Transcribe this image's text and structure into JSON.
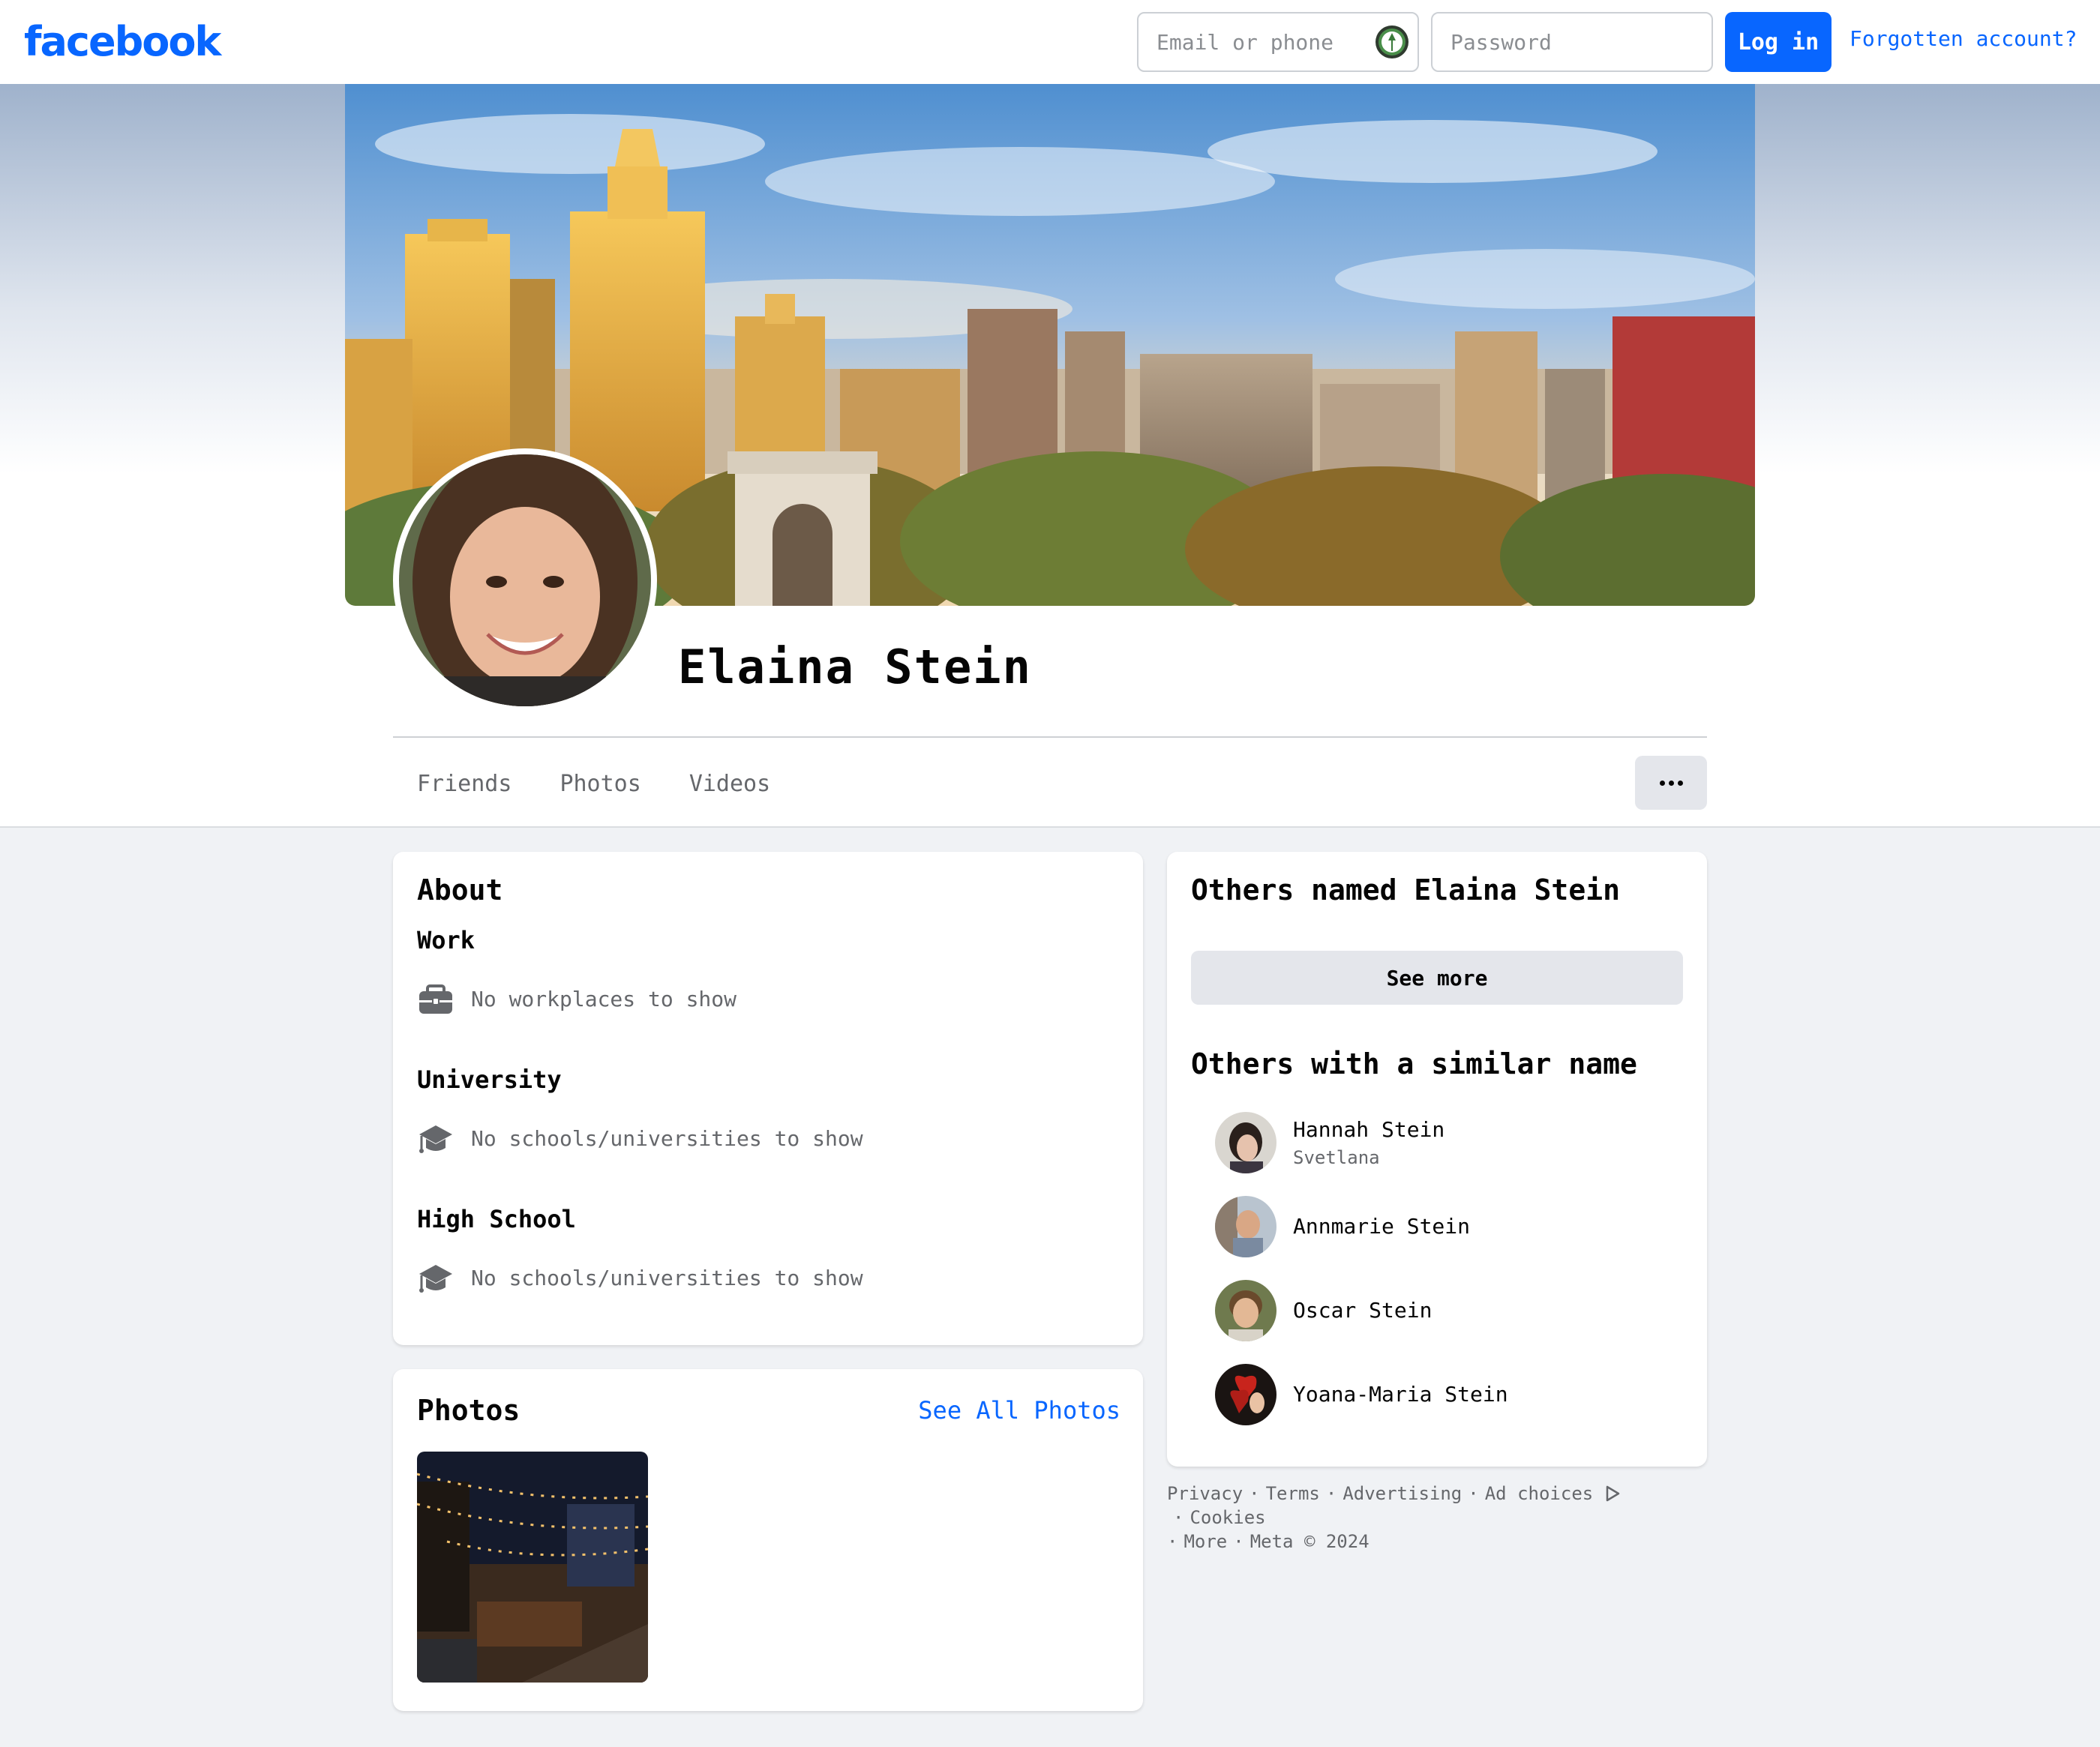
{
  "topbar": {
    "logo": "facebook",
    "email_placeholder": "Email or phone",
    "password_placeholder": "Password",
    "login_label": "Log in",
    "forgot_label": "Forgotten account?"
  },
  "profile": {
    "name": "Elaina Stein",
    "tabs": [
      "Friends",
      "Photos",
      "Videos"
    ]
  },
  "about": {
    "title": "About",
    "work": {
      "heading": "Work",
      "empty_text": "No workplaces to show"
    },
    "university": {
      "heading": "University",
      "empty_text": "No schools/universities to show"
    },
    "high_school": {
      "heading": "High School",
      "empty_text": "No schools/universities to show"
    }
  },
  "photos": {
    "title": "Photos",
    "see_all_label": "See All Photos"
  },
  "sidebar": {
    "others_named_title": "Others named Elaina Stein",
    "see_more_label": "See more",
    "similar_title": "Others with a similar name",
    "people": [
      {
        "name": "Hannah Stein",
        "subtitle": "Svetlana"
      },
      {
        "name": "Annmarie Stein",
        "subtitle": ""
      },
      {
        "name": "Oscar Stein",
        "subtitle": ""
      },
      {
        "name": "Yoana-Maria Stein",
        "subtitle": ""
      }
    ]
  },
  "footer": {
    "links": [
      "Privacy",
      "Terms",
      "Advertising",
      "Ad choices",
      "Cookies",
      "More"
    ],
    "copyright": "Meta © 2024"
  },
  "colors": {
    "brand": "#0866ff",
    "page_bg": "#f0f2f5",
    "secondary_text": "#65676b",
    "button_grey": "#e4e6eb"
  },
  "icons": [
    "password-manager-icon",
    "briefcase-icon",
    "graduation-cap-icon",
    "ad-choices-icon",
    "more-dots-icon"
  ]
}
